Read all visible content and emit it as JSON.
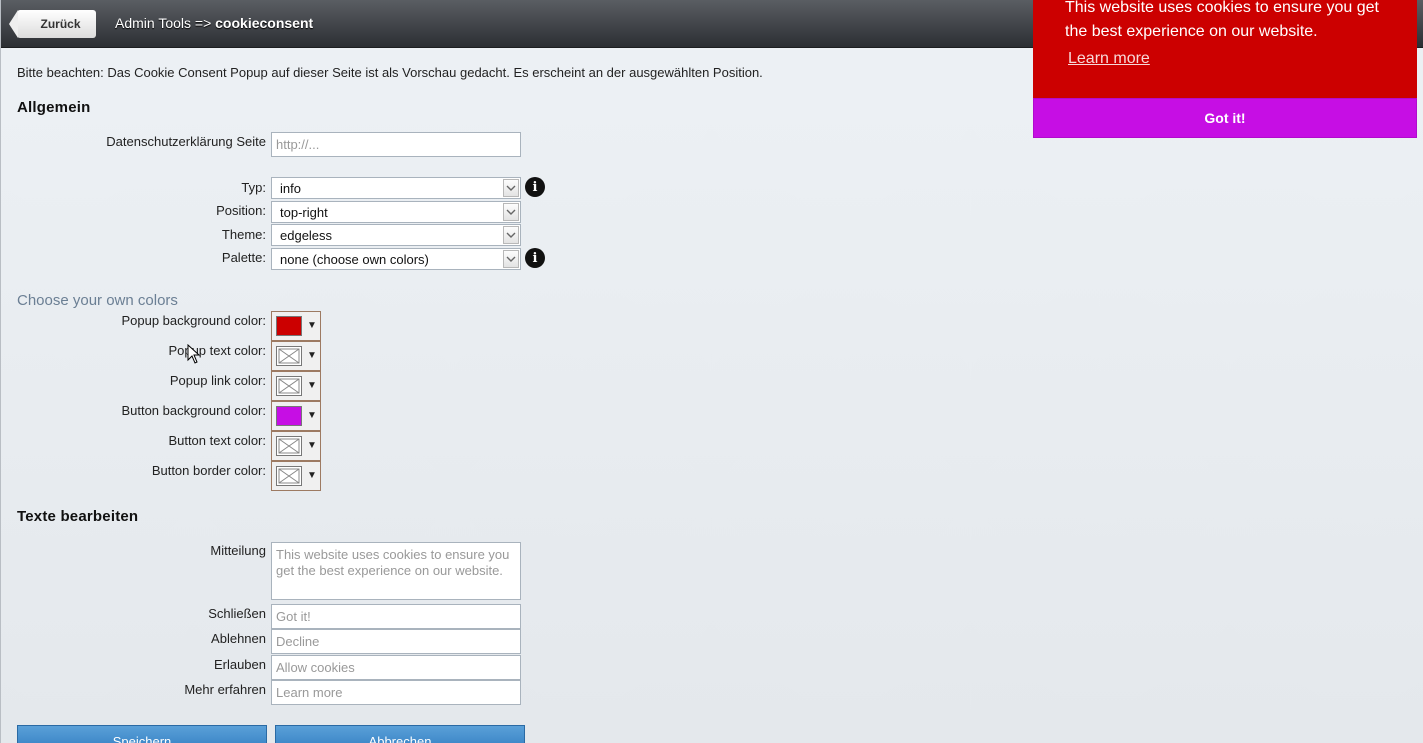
{
  "topbar": {
    "back_label": "Zurück",
    "crumb_prefix": "Admin Tools => ",
    "crumb_current": "cookieconsent"
  },
  "note": "Bitte beachten: Das Cookie Consent Popup auf dieser Seite ist als Vorschau gedacht. Es erscheint an der ausgewählten Position.",
  "general": {
    "heading": "Allgemein",
    "privacy_label": "Datenschutzerklärung Seite",
    "privacy_placeholder": "http://...",
    "type_label": "Typ:",
    "type_value": "info",
    "position_label": "Position:",
    "position_value": "top-right",
    "theme_label": "Theme:",
    "theme_value": "edgeless",
    "palette_label": "Palette:",
    "palette_value": "none (choose own colors)",
    "info_glyph": "i"
  },
  "colors": {
    "heading": "Choose your own colors",
    "popup_bg_label": "Popup background color:",
    "popup_bg_value": "#cc0000",
    "popup_text_label": "Popup text color:",
    "popup_link_label": "Popup link color:",
    "button_bg_label": "Button background color:",
    "button_bg_value": "#c60ee4",
    "button_text_label": "Button text color:",
    "button_border_label": "Button border color:",
    "dropdown_glyph": "▼"
  },
  "texts": {
    "heading": "Texte bearbeiten",
    "message_label": "Mitteilung",
    "message_placeholder": "This website uses cookies to ensure you get the best experience on our website.",
    "close_label": "Schließen",
    "close_placeholder": "Got it!",
    "decline_label": "Ablehnen",
    "decline_placeholder": "Decline",
    "allow_label": "Erlauben",
    "allow_placeholder": "Allow cookies",
    "more_label": "Mehr erfahren",
    "more_placeholder": "Learn more"
  },
  "actions": {
    "save_label": "Speichern",
    "cancel_label": "Abbrechen"
  },
  "cookie_preview": {
    "message": "This website uses cookies to ensure you get the best experience on our website.",
    "link_label": "Learn more",
    "button_label": "Got it!"
  }
}
